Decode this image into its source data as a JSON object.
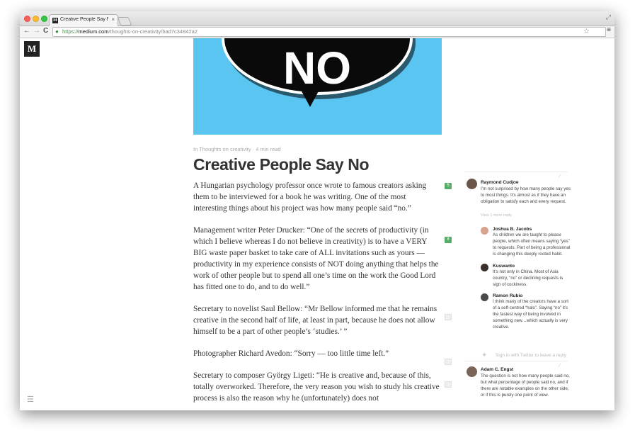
{
  "browser": {
    "tab_title": "Creative People Say No",
    "tab_close": "×",
    "url_scheme": "https://",
    "url_domain": "medium.com",
    "url_path": "/thoughts-on-creativity/bad7c34842a2",
    "back": "←",
    "forward": "→",
    "reload": "C",
    "star": "☆",
    "menu": "≡",
    "expand": "⤢"
  },
  "site": {
    "logo": "M"
  },
  "hero": {
    "text": "NO"
  },
  "article": {
    "meta": "In Thoughts on creativity · 4 min read",
    "title": "Creative People Say No",
    "paragraphs": [
      "A Hungarian psychology professor once wrote to famous creators asking them to be interviewed for a book he was writing.  One of the most interesting things about his project was how many people said “no.”",
      "Management writer Peter Drucker: “One of the secrets of productivity (in which I believe whereas I do not believe in creativity) is to have a VERY BIG waste paper basket to take care of ALL invitations such as yours — productivity in my experience consists of NOT doing anything that helps the work of other people but to spend all one’s time on the work the Good Lord has fitted one to do, and to do well.”",
      "Secretary to novelist Saul Bellow: “Mr Bellow informed me that he remains creative in the second half of life, at least in part, because he does not allow himself to be a part of other people’s ‘studies.’ ”",
      "Photographer Richard Avedon: “Sorry — too little time left.”",
      "Secretary to composer György Ligeti: “He is creative and, because of this, totally overworked. Therefore, the very reason you wish to study his creative process is also the reason why he (unfortunately) does not"
    ],
    "notes": [
      "5",
      "8",
      "",
      "",
      ""
    ]
  },
  "responses": [
    {
      "name": "Raymond Cudjoe",
      "text": "I’m not surprised by how many people say yes to most things. It’s almost as if they have an obligation to satisfy each and every request.",
      "reply": "View 1 more reply"
    },
    {
      "name": "Joshua B. Jacobs",
      "text": "As children we are taught to please people, which often means saying “yes” to requests. Part of being a professional is changing this deeply rooted habit."
    },
    {
      "name": "Kuswanto",
      "text": "It’s not only in China. Most of Asia country, “no” or declining requests is sign of cockiness."
    },
    {
      "name": "Ramon Rubio",
      "text": "I think many of the creators have a sort of a self-centred “halo”. Saying “no” it’s the fastest way of being involved in something new…which actually is very creative."
    },
    {
      "name": "Adam C. Engst",
      "text": "The question is not how many people said no, but what percentage of people said no, and if there are notable examples on the other side, or if this is purely one point of view."
    }
  ],
  "sign_in": "Sign in with Twitter to leave a reply"
}
